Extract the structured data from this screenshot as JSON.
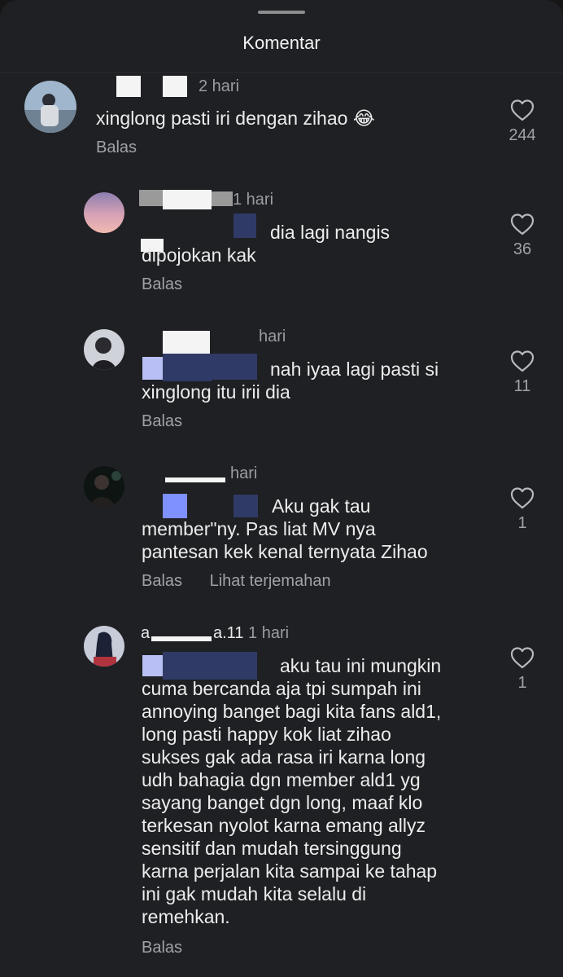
{
  "header": {
    "title": "Komentar"
  },
  "comments": [
    {
      "time": "2 hari",
      "text": "xinglong pasti iri dengan zihao",
      "emoji": "😂",
      "reply_label": "Balas",
      "likes": "244"
    },
    {
      "time": "1 hari",
      "text_line1": "dia lagi nangis",
      "text_line2": "dipojokan kak",
      "reply_label": "Balas",
      "likes": "36"
    },
    {
      "time": "hari",
      "text_line1": "nah iyaa lagi pasti si",
      "text_line2": "xinglong itu irii dia",
      "reply_label": "Balas",
      "likes": "11"
    },
    {
      "time": "hari",
      "text_line1": "Aku gak tau",
      "text_line2": "member\"ny. Pas liat MV nya",
      "text_line3": "pantesan kek kenal ternyata Zihao",
      "reply_label": "Balas",
      "translate_label": "Lihat terjemahan",
      "likes": "1"
    },
    {
      "name": "a.11",
      "time": "1 hari",
      "text_line1": "aku tau ini mungkin",
      "text_rest": [
        "cuma bercanda aja tpi sumpah ini",
        "annoying banget bagi kita fans ald1,",
        "long pasti happy kok liat zihao",
        "sukses gak ada rasa iri karna long",
        "udh bahagia dgn member ald1 yg",
        "sayang banget dgn long, maaf klo",
        "terkesan nyolot karna emang allyz",
        "sensitif dan mudah tersinggung",
        "karna perjalan kita sampai ke tahap",
        "ini gak mudah kita selalu di",
        "remehkan."
      ],
      "reply_label": "Balas",
      "likes": "1"
    }
  ],
  "colors": {
    "background": "#1f2023",
    "mention": "#8da3ff",
    "muted": "#a1a2a6"
  },
  "icons": {
    "like": "heart-outline-icon"
  }
}
